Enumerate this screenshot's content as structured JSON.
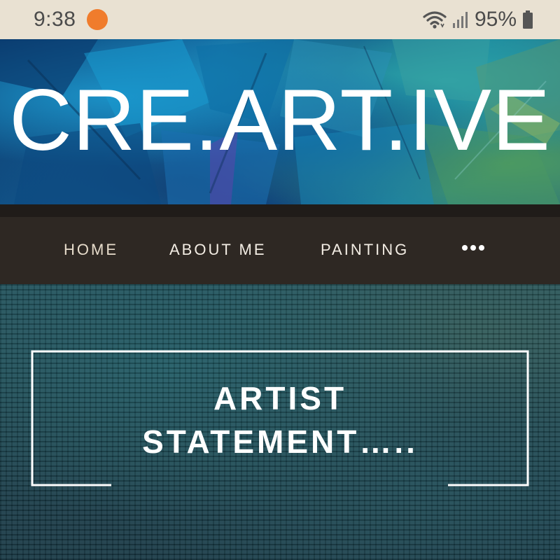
{
  "status_bar": {
    "time": "9:38",
    "battery": "95%",
    "notification_color": "#f07c2c",
    "icons": [
      "wifi-icon",
      "signal-icon",
      "battery-icon"
    ]
  },
  "site": {
    "title": "CRE.ART.IVE"
  },
  "nav": {
    "items": [
      {
        "label": "HOME"
      },
      {
        "label": "ABOUT ME"
      },
      {
        "label": "PAINTING"
      }
    ],
    "more_icon": "more-dots-icon"
  },
  "content": {
    "statement_line1": "ARTIST",
    "statement_line2": "STATEMENT….."
  },
  "colors": {
    "status_bar_bg": "#e9e1d2",
    "nav_bg": "#2e2823",
    "title_color": "#ffffff"
  }
}
